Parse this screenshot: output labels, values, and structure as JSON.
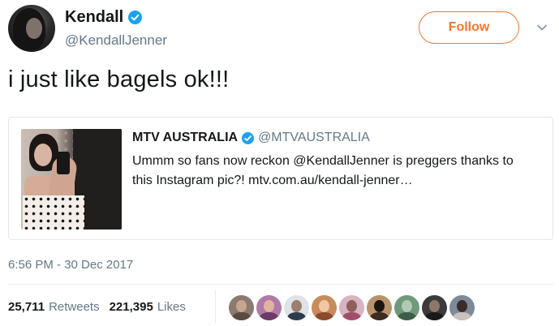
{
  "author": {
    "display_name": "Kendall",
    "handle": "@KendallJenner",
    "verified": true,
    "avatar_icon": "profile-photo"
  },
  "follow_button": {
    "label": "Follow",
    "color": "#f4762b"
  },
  "more_menu_icon": "chevron-down-icon",
  "tweet": {
    "text": "i just like bagels ok!!!",
    "timestamp": "6:56 PM - 30 Dec 2017"
  },
  "quoted_tweet": {
    "display_name": "MTV AUSTRALIA",
    "handle": "@MTVAUSTRALIA",
    "verified": true,
    "body_line1": "Ummm so fans now reckon @KendallJenner is preggers thanks to",
    "body_line2": "this Instagram pic?! mtv.com.au/kendall-jenner…",
    "image_icon": "photo-thumbnail"
  },
  "stats": {
    "retweets_count": "25,711",
    "retweets_label": "Retweets",
    "likes_count": "221,395",
    "likes_label": "Likes"
  },
  "likers": [
    {
      "bg": "#8a7a70",
      "head": "#c9a48d",
      "body": "#5b4a42"
    },
    {
      "bg": "#b07aa6",
      "head": "#e2b3a2",
      "body": "#6b3b63"
    },
    {
      "bg": "#dfe3e8",
      "head": "#9d7d6c",
      "body": "#2f3b4c"
    },
    {
      "bg": "#c98a5c",
      "head": "#f0c7a2",
      "body": "#8b4b2c"
    },
    {
      "bg": "#d8b3c1",
      "head": "#8f5f5a",
      "body": "#a24c6c"
    },
    {
      "bg": "#b8926a",
      "head": "#1b1511",
      "body": "#3a2c22"
    },
    {
      "bg": "#6f9a7a",
      "head": "#b1c9b6",
      "body": "#3e5d47"
    },
    {
      "bg": "#3b3b3b",
      "head": "#8d7767",
      "body": "#1a1a1a"
    },
    {
      "bg": "#7d8a99",
      "head": "#3a2c2a",
      "body": "#c9c2bd"
    }
  ],
  "colors": {
    "verified_badge": "#1da1f2",
    "secondary_text": "#657786",
    "primary_text": "#14171a",
    "border": "#e1e8ed"
  }
}
